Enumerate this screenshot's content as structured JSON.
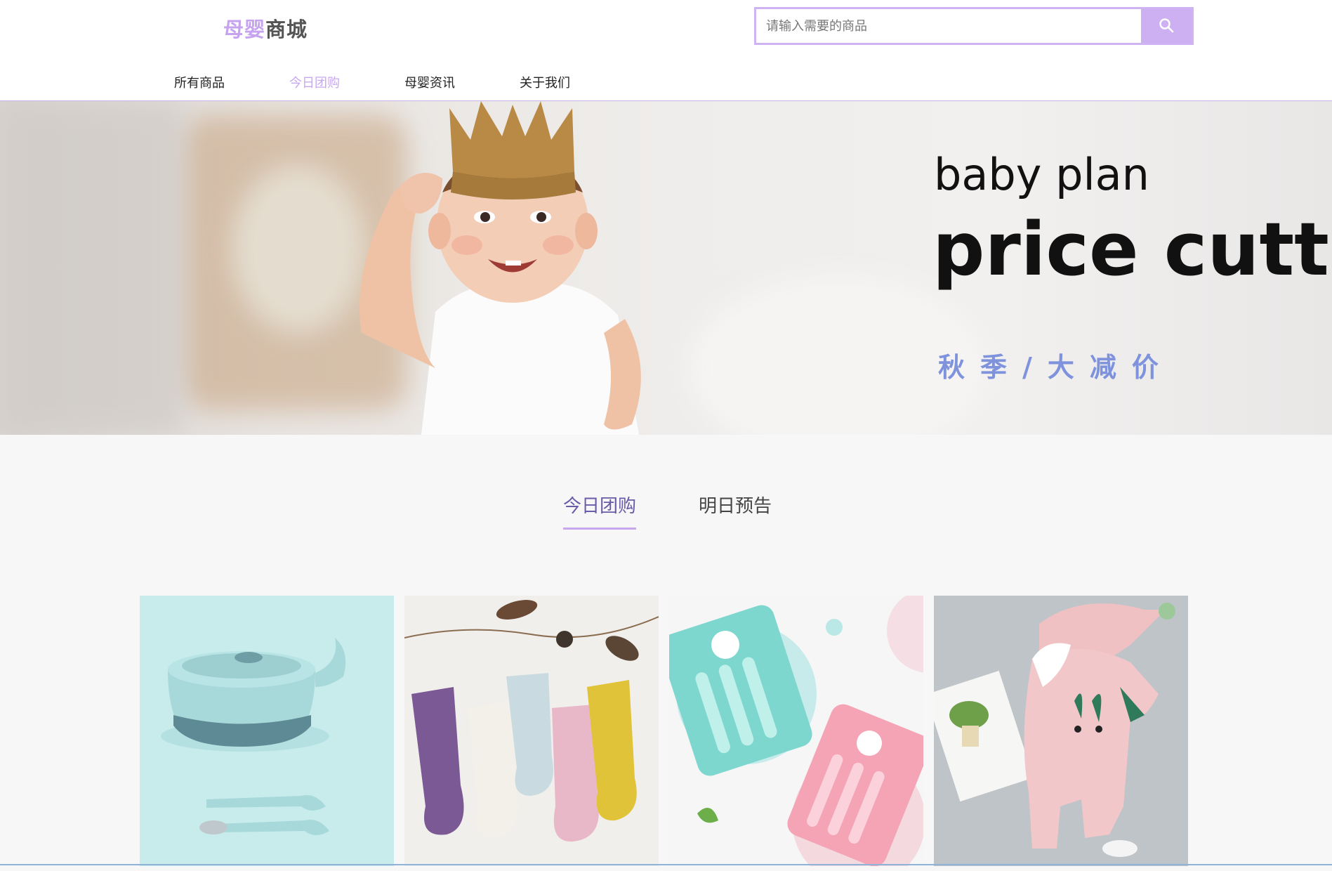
{
  "header": {
    "logo": {
      "part1": "母婴",
      "part2": "商城"
    },
    "search": {
      "placeholder": "请输入需要的商品",
      "button_icon": "search-icon"
    }
  },
  "nav": {
    "items": [
      {
        "label": "所有商品",
        "active": false
      },
      {
        "label": "今日团购",
        "active": true
      },
      {
        "label": "母婴资讯",
        "active": false
      },
      {
        "label": "关于我们",
        "active": false
      }
    ]
  },
  "banner": {
    "line1": "baby plan",
    "line2": "price cuttin",
    "line3": "秋季/大减价"
  },
  "tabs": [
    {
      "label": "今日团购",
      "active": true
    },
    {
      "label": "明日预告",
      "active": false
    }
  ],
  "products": [
    {
      "name": "baby-bowl-spoon-set"
    },
    {
      "name": "baby-socks"
    },
    {
      "name": "baby-play-mat-fence"
    },
    {
      "name": "baby-romper"
    }
  ],
  "colors": {
    "accent": "#c8a8f0",
    "tab_active_text": "#6a5aa8",
    "banner_slogan": "#7f93dd",
    "page_bg": "#f7f7f7"
  }
}
